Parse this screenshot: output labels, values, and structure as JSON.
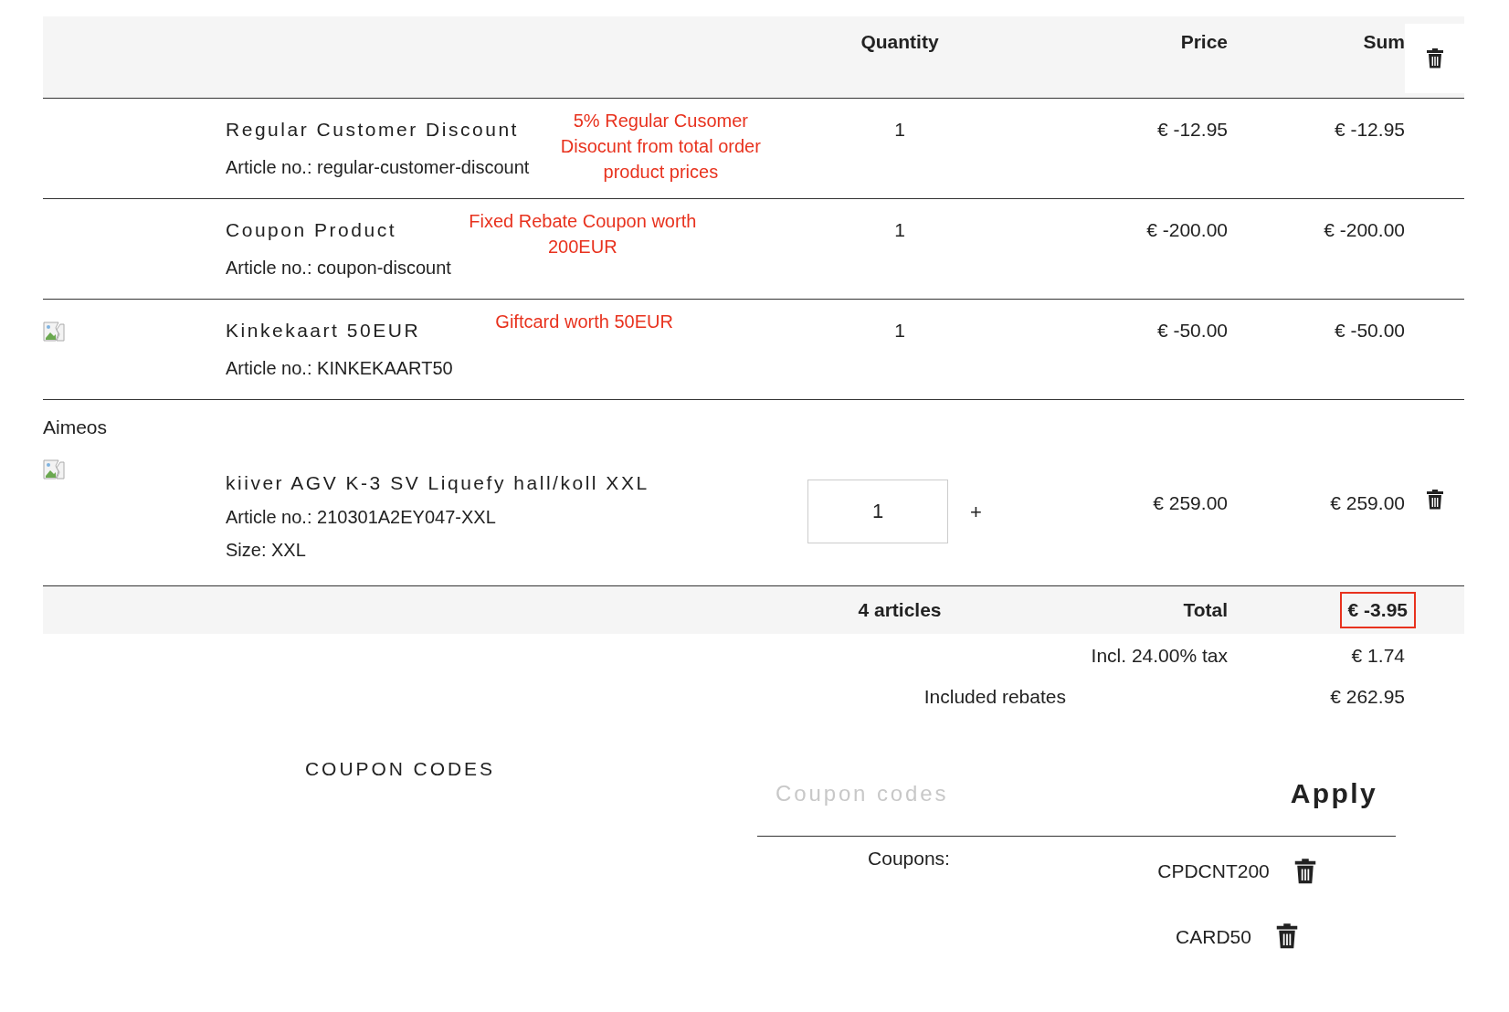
{
  "columns": [
    "Quantity",
    "Price",
    "Sum"
  ],
  "header_delete": true,
  "groups": [
    {
      "items": [
        {
          "name": "Regular Customer Discount",
          "article": "Article no.: regular-customer-discount",
          "annotation": "5% Regular Cusomer Disocunt from total order product prices",
          "quantity": "1",
          "price": "€ -12.95",
          "sum": "€ -12.95",
          "image": false,
          "editable": false,
          "removable": false
        },
        {
          "name": "Coupon Product",
          "article": "Article no.: coupon-discount",
          "annotation": "Fixed Rebate Coupon worth 200EUR",
          "quantity": "1",
          "price": "€ -200.00",
          "sum": "€ -200.00",
          "image": false,
          "editable": false,
          "removable": false
        },
        {
          "name": "Kinkekaart 50EUR",
          "article": "Article no.: KINKEKAART50",
          "annotation": "Giftcard worth 50EUR",
          "quantity": "1",
          "price": "€ -50.00",
          "sum": "€ -50.00",
          "image": true,
          "editable": false,
          "removable": false
        }
      ]
    },
    {
      "supplier": "Aimeos",
      "items": [
        {
          "name": "kiiver AGV K-3 SV Liquefy hall/koll XXL",
          "article": "Article no.: 210301A2EY047-XXL",
          "size": "Size: XXL",
          "quantity": "1",
          "increment": "+",
          "price": "€ 259.00",
          "sum": "€ 259.00",
          "image": true,
          "editable": true,
          "removable": true
        }
      ]
    }
  ],
  "total": {
    "count": "4 articles",
    "label": "Total",
    "value": "€ -3.95",
    "highlighted": true
  },
  "tax": {
    "label": "Incl. 24.00% tax",
    "value": "€ 1.74"
  },
  "rebates": {
    "label": "Included rebates",
    "value": "€ 262.95"
  },
  "coupon": {
    "heading": "COUPON CODES",
    "placeholder": "Coupon codes",
    "button": "Apply",
    "list_label": "Coupons:",
    "codes": [
      "CPDCNT200",
      "CARD50"
    ]
  }
}
